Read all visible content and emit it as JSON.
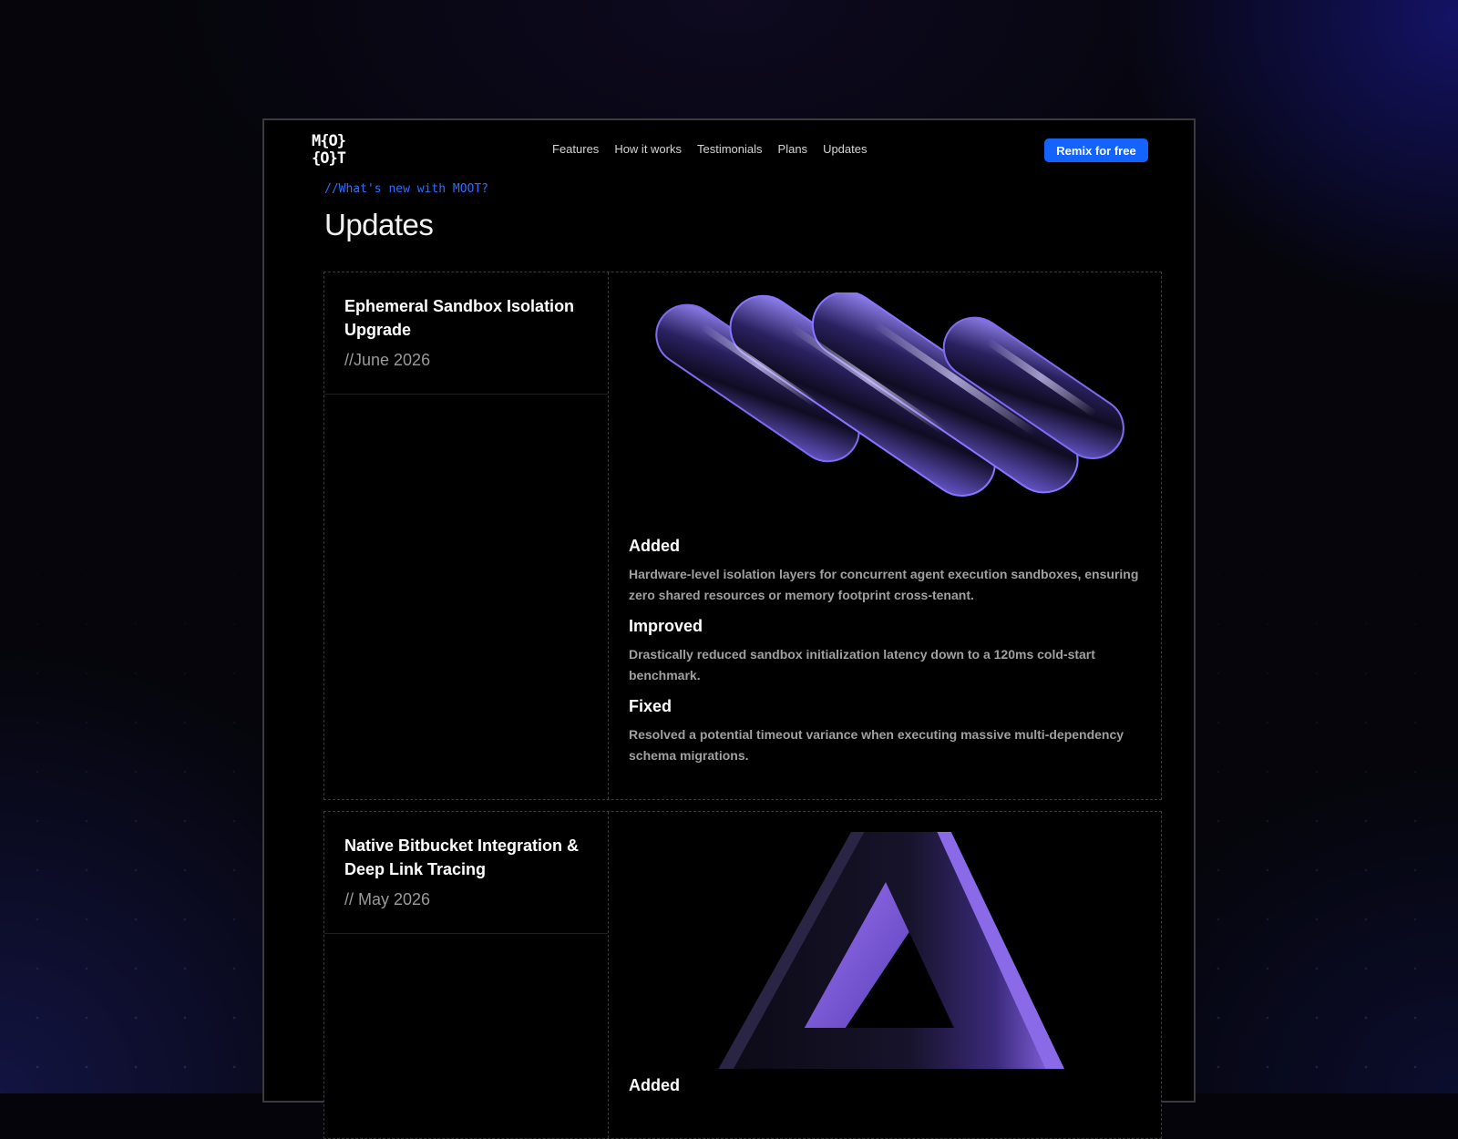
{
  "brand": {
    "logo_line1": "M{O}",
    "logo_line2": "{O}T"
  },
  "nav": {
    "items": [
      "Features",
      "How it works",
      "Testimonials",
      "Plans",
      "Updates"
    ]
  },
  "cta": {
    "label": "Remix for free"
  },
  "header": {
    "eyebrow": "//What's new with MOOT?",
    "title": "Updates"
  },
  "updates": [
    {
      "title": "Ephemeral Sandbox Isolation Upgrade",
      "date": "//June 2026",
      "changes": [
        {
          "type": "Added",
          "text": "Hardware-level isolation layers for concurrent agent execution sandboxes, ensuring zero shared resources or memory footprint cross-tenant."
        },
        {
          "type": "Improved",
          "text": "Drastically reduced sandbox initialization latency down to a 120ms cold-start benchmark."
        },
        {
          "type": "Fixed",
          "text": "Resolved a potential timeout variance when executing massive multi-dependency schema migrations."
        }
      ]
    },
    {
      "title": "Native Bitbucket Integration & Deep Link Tracing",
      "date": "// May 2026",
      "changes": [
        {
          "type": "Added",
          "text": ""
        }
      ]
    }
  ],
  "colors": {
    "accent": "#1463ff",
    "eyebrow": "#2f6dff",
    "art_purple": "#7a5cff"
  },
  "icons": {
    "logo": "moot-logo-icon",
    "art1": "glass-coil-illustration",
    "art2": "glass-triangle-illustration"
  }
}
